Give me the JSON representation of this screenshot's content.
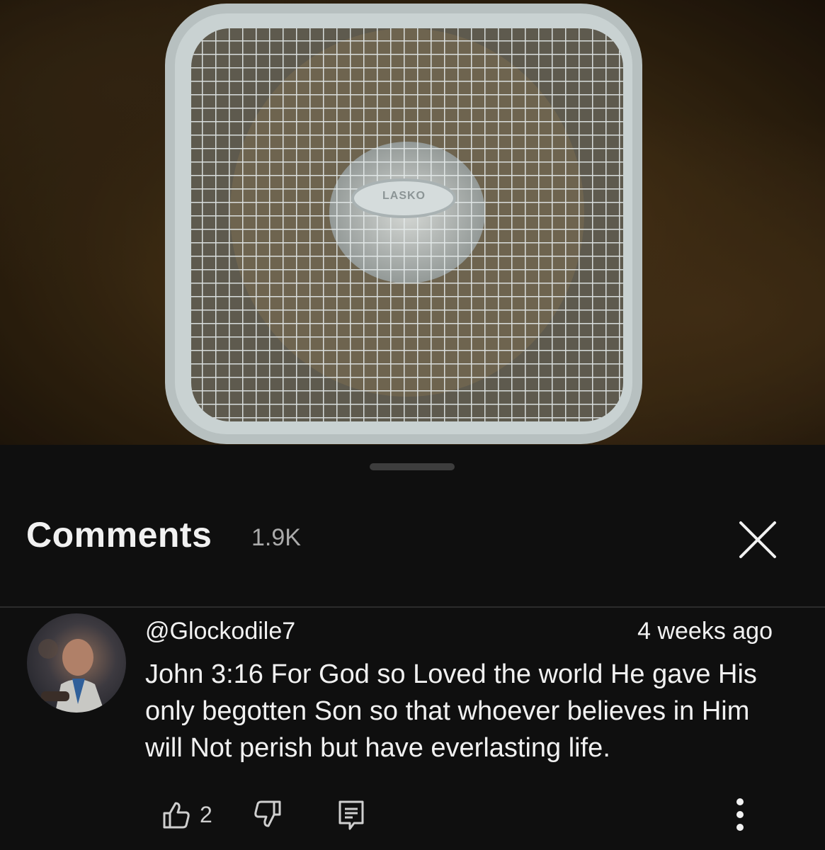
{
  "comments_panel": {
    "title": "Comments",
    "count": "1.9K"
  },
  "comment": {
    "author": "@Glockodile7",
    "time": "4 weeks ago",
    "text": "John 3:16 For God so Loved the world He gave His only begotten Son so that whoever believes in Him will Not perish but have everlasting life.",
    "likes": "2"
  },
  "video": {
    "fan_brand": "LASKO"
  },
  "icons": {
    "close": "close-icon",
    "like": "thumbs-up-icon",
    "dislike": "thumbs-down-icon",
    "reply": "reply-icon",
    "more": "more-vertical-icon"
  }
}
